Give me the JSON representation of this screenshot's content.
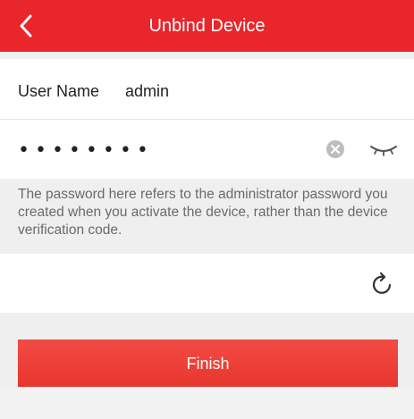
{
  "header": {
    "title": "Unbind Device",
    "back_icon": "chevron-left-icon"
  },
  "account": {
    "user_name_label": "User Name",
    "user_name_value": "admin"
  },
  "password": {
    "value": "••••••••",
    "clear_icon": "clear-icon",
    "visibility_icon": "eye-closed-icon"
  },
  "hint": {
    "text": "The password here refers to the administrator password you created when you activate the device, rather than the device verification code."
  },
  "verification": {
    "value": "",
    "refresh_icon": "refresh-icon"
  },
  "actions": {
    "finish_label": "Finish"
  },
  "colors": {
    "brand": "#e8262b",
    "background": "#efefef",
    "text": "#222222",
    "hint": "#6a6a6a"
  }
}
